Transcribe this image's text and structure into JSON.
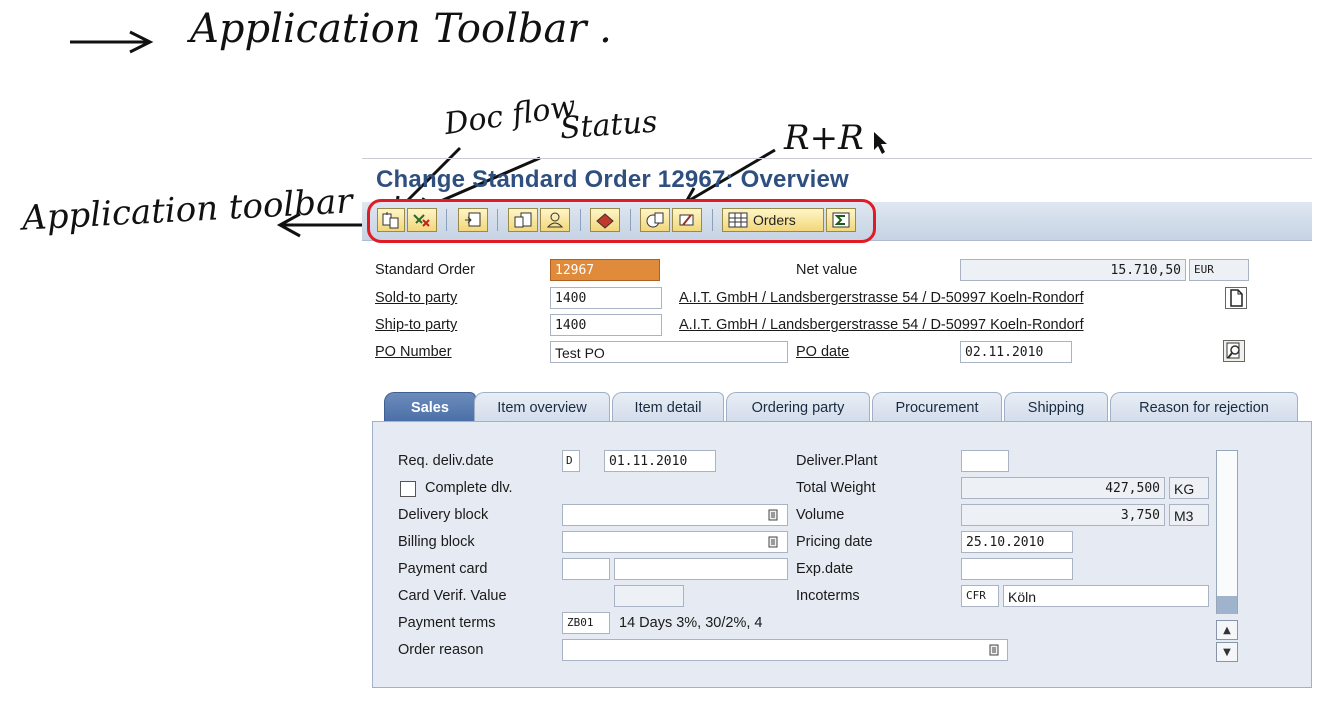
{
  "annotations": {
    "top_note": "Application Toolbar .",
    "doc_flow": "Doc flow",
    "status": "Status",
    "r_r": "R+R",
    "left_note": "Application toolbar"
  },
  "window": {
    "title": "Change Standard Order 12967: Overview"
  },
  "toolbar": {
    "buttons": [
      {
        "icon": "document-flow-icon"
      },
      {
        "icon": "status-overview-icon"
      },
      {
        "icon": "display-document-icon"
      },
      {
        "icon": "header-details-icon"
      },
      {
        "icon": "partner-icon"
      },
      {
        "icon": "create-delivery-icon"
      },
      {
        "icon": "copy-icon"
      },
      {
        "icon": "return-refund-icon"
      },
      {
        "icon": "table-grid-icon"
      },
      {
        "icon": "sum-icon"
      }
    ],
    "orders_label": "Orders"
  },
  "header": {
    "standard_order_label": "Standard Order",
    "standard_order_value": "12967",
    "net_value_label": "Net value",
    "net_value": "15.710,50",
    "currency": "EUR",
    "sold_to_label": "Sold-to party",
    "sold_to_value": "1400",
    "sold_to_address": "A.I.T. GmbH / Landsbergerstrasse 54 / D-50997 Koeln-Rondorf",
    "ship_to_label": "Ship-to party",
    "ship_to_value": "1400",
    "ship_to_address": "A.I.T. GmbH / Landsbergerstrasse 54 / D-50997 Koeln-Rondorf",
    "po_number_label": "PO Number",
    "po_number_value": "Test PO",
    "po_date_label": "PO date",
    "po_date_value": "02.11.2010"
  },
  "tabs": [
    {
      "label": "Sales",
      "active": true
    },
    {
      "label": "Item overview",
      "active": false
    },
    {
      "label": "Item detail",
      "active": false
    },
    {
      "label": "Ordering party",
      "active": false
    },
    {
      "label": "Procurement",
      "active": false
    },
    {
      "label": "Shipping",
      "active": false
    },
    {
      "label": "Reason for rejection",
      "active": false
    }
  ],
  "sales": {
    "req_deliv_label": "Req. deliv.date",
    "req_deliv_type": "D",
    "req_deliv_value": "01.11.2010",
    "complete_dlv_label": "Complete dlv.",
    "complete_dlv_checked": false,
    "delivery_block_label": "Delivery block",
    "delivery_block_value": "",
    "billing_block_label": "Billing block",
    "billing_block_value": "",
    "payment_card_label": "Payment card",
    "payment_card_value": "",
    "card_verif_label": "Card Verif. Value",
    "card_verif_value": "",
    "payment_terms_label": "Payment terms",
    "payment_terms_code": "ZB01",
    "payment_terms_text": "14 Days 3%, 30/2%, 4",
    "order_reason_label": "Order reason",
    "order_reason_value": "",
    "deliver_plant_label": "Deliver.Plant",
    "deliver_plant_value": "",
    "total_weight_label": "Total Weight",
    "total_weight_value": "427,500",
    "total_weight_unit": "KG",
    "volume_label": "Volume",
    "volume_value": "3,750",
    "volume_unit": "M3",
    "pricing_date_label": "Pricing date",
    "pricing_date_value": "25.10.2010",
    "exp_date_label": "Exp.date",
    "exp_date_value": "",
    "incoterms_label": "Incoterms",
    "incoterms_code": "CFR",
    "incoterms_place": "Köln"
  },
  "colors": {
    "title": "#2f4f80",
    "annotation_red": "#e01b24",
    "active_tab": "#4a6ea6",
    "highlight_field": "#e08a3c"
  }
}
